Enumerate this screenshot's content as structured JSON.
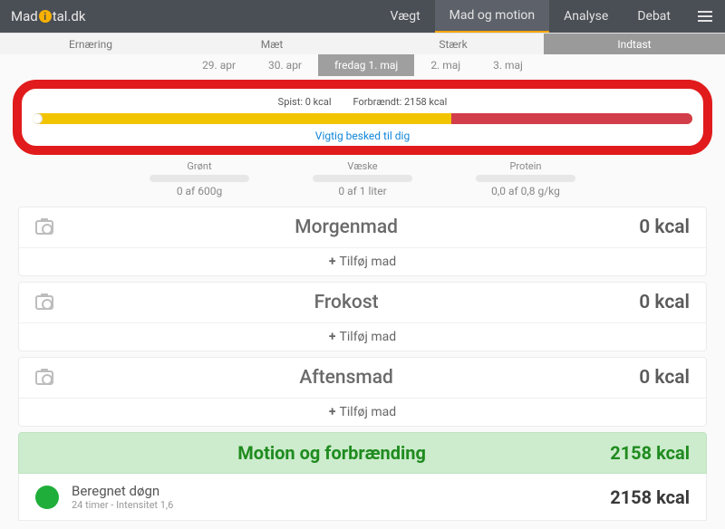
{
  "brand": {
    "pre": "Mad",
    "post": "tal.dk",
    "o": "i"
  },
  "nav": {
    "items": [
      {
        "label": "Vægt"
      },
      {
        "label": "Mad og motion"
      },
      {
        "label": "Analyse"
      },
      {
        "label": "Debat"
      }
    ],
    "active_index": 1
  },
  "subtabs": {
    "items": [
      {
        "label": "Ernæring"
      },
      {
        "label": "Mæt"
      },
      {
        "label": "Stærk"
      },
      {
        "label": "Indtast"
      }
    ],
    "active_index": 3
  },
  "dates": {
    "items": [
      {
        "label": "29. apr"
      },
      {
        "label": "30. apr"
      },
      {
        "label": "fredag 1. maj"
      },
      {
        "label": "2. maj"
      },
      {
        "label": "3. maj"
      }
    ],
    "active_index": 2
  },
  "calorie_bar": {
    "spist_label": "Spist: 0 kcal",
    "burn_label": "Forbrændt: 2158 kcal",
    "message": "Vigtig besked til dig"
  },
  "minis": [
    {
      "label": "Grønt",
      "value": "0 af 600g"
    },
    {
      "label": "Væske",
      "value": "0 af 1 liter"
    },
    {
      "label": "Protein",
      "value": "0,0 af 0,8 g/kg"
    }
  ],
  "add_label": "Tilføj mad",
  "meals": [
    {
      "title": "Morgenmad",
      "kcal": "0 kcal"
    },
    {
      "title": "Frokost",
      "kcal": "0 kcal"
    },
    {
      "title": "Aftensmad",
      "kcal": "0 kcal"
    }
  ],
  "motion": {
    "title": "Motion og forbrænding",
    "total_kcal": "2158 kcal",
    "row": {
      "title": "Beregnet døgn",
      "subtitle": "24 timer - Intensitet 1,6",
      "kcal": "2158 kcal"
    }
  }
}
